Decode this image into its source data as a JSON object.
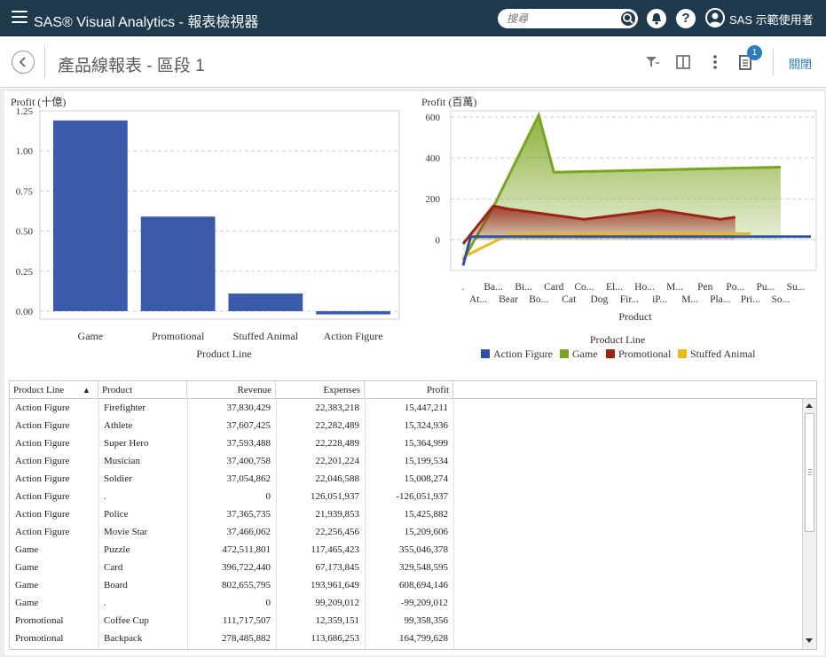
{
  "app": {
    "title": "SAS® Visual Analytics - 報表檢視器",
    "search_placeholder": "搜尋",
    "help_label": "?",
    "user_name": "SAS 示範使用者"
  },
  "report": {
    "title": "產品線報表 - 區段 1",
    "notification_count": "1",
    "close_label": "關閉"
  },
  "colors": {
    "appbar": "#1f3a4d",
    "bar": "#3a5aab",
    "action_figure": "#2e4e9e",
    "game": "#7aa520",
    "promotional": "#9b2519",
    "stuffed_animal": "#e8b81f",
    "link": "#2b7dbf"
  },
  "chart_data": [
    {
      "type": "bar",
      "ylabel": "Profit (十億)",
      "xlabel": "Product Line",
      "categories": [
        "Game",
        "Promotional",
        "Stuffed Animal",
        "Action Figure"
      ],
      "values": [
        1.19,
        0.59,
        0.11,
        -0.02
      ],
      "ylim": [
        -0.05,
        1.25
      ],
      "yticks": [
        "1.25",
        "1.00",
        "0.75",
        "0.50",
        "0.25",
        "0.00"
      ],
      "grid": true
    },
    {
      "type": "area",
      "ylabel": "Profit (百萬)",
      "xlabel": "Product",
      "legend_title": "Product Line",
      "legend_position": "bottom",
      "yticks": [
        "600",
        "400",
        "200",
        "0"
      ],
      "ylim": [
        -150,
        630
      ],
      "x_row1": [
        ".",
        "Ba...",
        "Bi...",
        "Card",
        "Co...",
        "El...",
        "Ho...",
        "M...",
        "Pen",
        "Po...",
        "Pu...",
        "Su..."
      ],
      "x_row2": [
        "At...",
        "Bear",
        "Bo...",
        "Cat",
        "Dog",
        "Fir...",
        "iP...",
        "M...",
        "Pla...",
        "Pri...",
        "So..."
      ],
      "series": [
        {
          "name": "Action Figure",
          "x": [
            0,
            0.5,
            23
          ],
          "values": [
            -126,
            15,
            15
          ]
        },
        {
          "name": "Game",
          "x": [
            0,
            2,
            5,
            6,
            21
          ],
          "values": [
            -99,
            160,
            609,
            330,
            355
          ]
        },
        {
          "name": "Promotional",
          "x": [
            0,
            2,
            3,
            5,
            8,
            13,
            17,
            18
          ],
          "values": [
            -20,
            165,
            150,
            130,
            100,
            145,
            100,
            110
          ]
        },
        {
          "name": "Stuffed Animal",
          "x": [
            0,
            3,
            19
          ],
          "values": [
            -85,
            25,
            30
          ]
        }
      ]
    }
  ],
  "table": {
    "columns": [
      "Product Line",
      "Product",
      "Revenue",
      "Expenses",
      "Profit"
    ],
    "sort_indicator": "▲",
    "rows": [
      [
        "Action Figure",
        "Firefighter",
        "37,830,429",
        "22,383,218",
        "15,447,211"
      ],
      [
        "Action Figure",
        "Athlete",
        "37,607,425",
        "22,282,489",
        "15,324,936"
      ],
      [
        "Action Figure",
        "Super Hero",
        "37,593,488",
        "22,228,489",
        "15,364,999"
      ],
      [
        "Action Figure",
        "Musician",
        "37,400,758",
        "22,201,224",
        "15,199,534"
      ],
      [
        "Action Figure",
        "Soldier",
        "37,054,862",
        "22,046,588",
        "15,008,274"
      ],
      [
        "Action Figure",
        ".",
        "0",
        "126,051,937",
        "-126,051,937"
      ],
      [
        "Action Figure",
        "Police",
        "37,365,735",
        "21,939,853",
        "15,425,882"
      ],
      [
        "Action Figure",
        "Movie Star",
        "37,466,062",
        "22,256,456",
        "15,209,606"
      ],
      [
        "Game",
        "Puzzle",
        "472,511,801",
        "117,465,423",
        "355,046,378"
      ],
      [
        "Game",
        "Card",
        "396,722,440",
        "67,173,845",
        "329,548,595"
      ],
      [
        "Game",
        "Board",
        "802,655,795",
        "193,961,649",
        "608,694,146"
      ],
      [
        "Game",
        ".",
        "0",
        "99,209,012",
        "-99,209,012"
      ],
      [
        "Promotional",
        "Coffee Cup",
        "111,717,507",
        "12,359,151",
        "99,358,356"
      ],
      [
        "Promotional",
        "Backpack",
        "278,485,882",
        "113,686,253",
        "164,799,628"
      ]
    ]
  }
}
